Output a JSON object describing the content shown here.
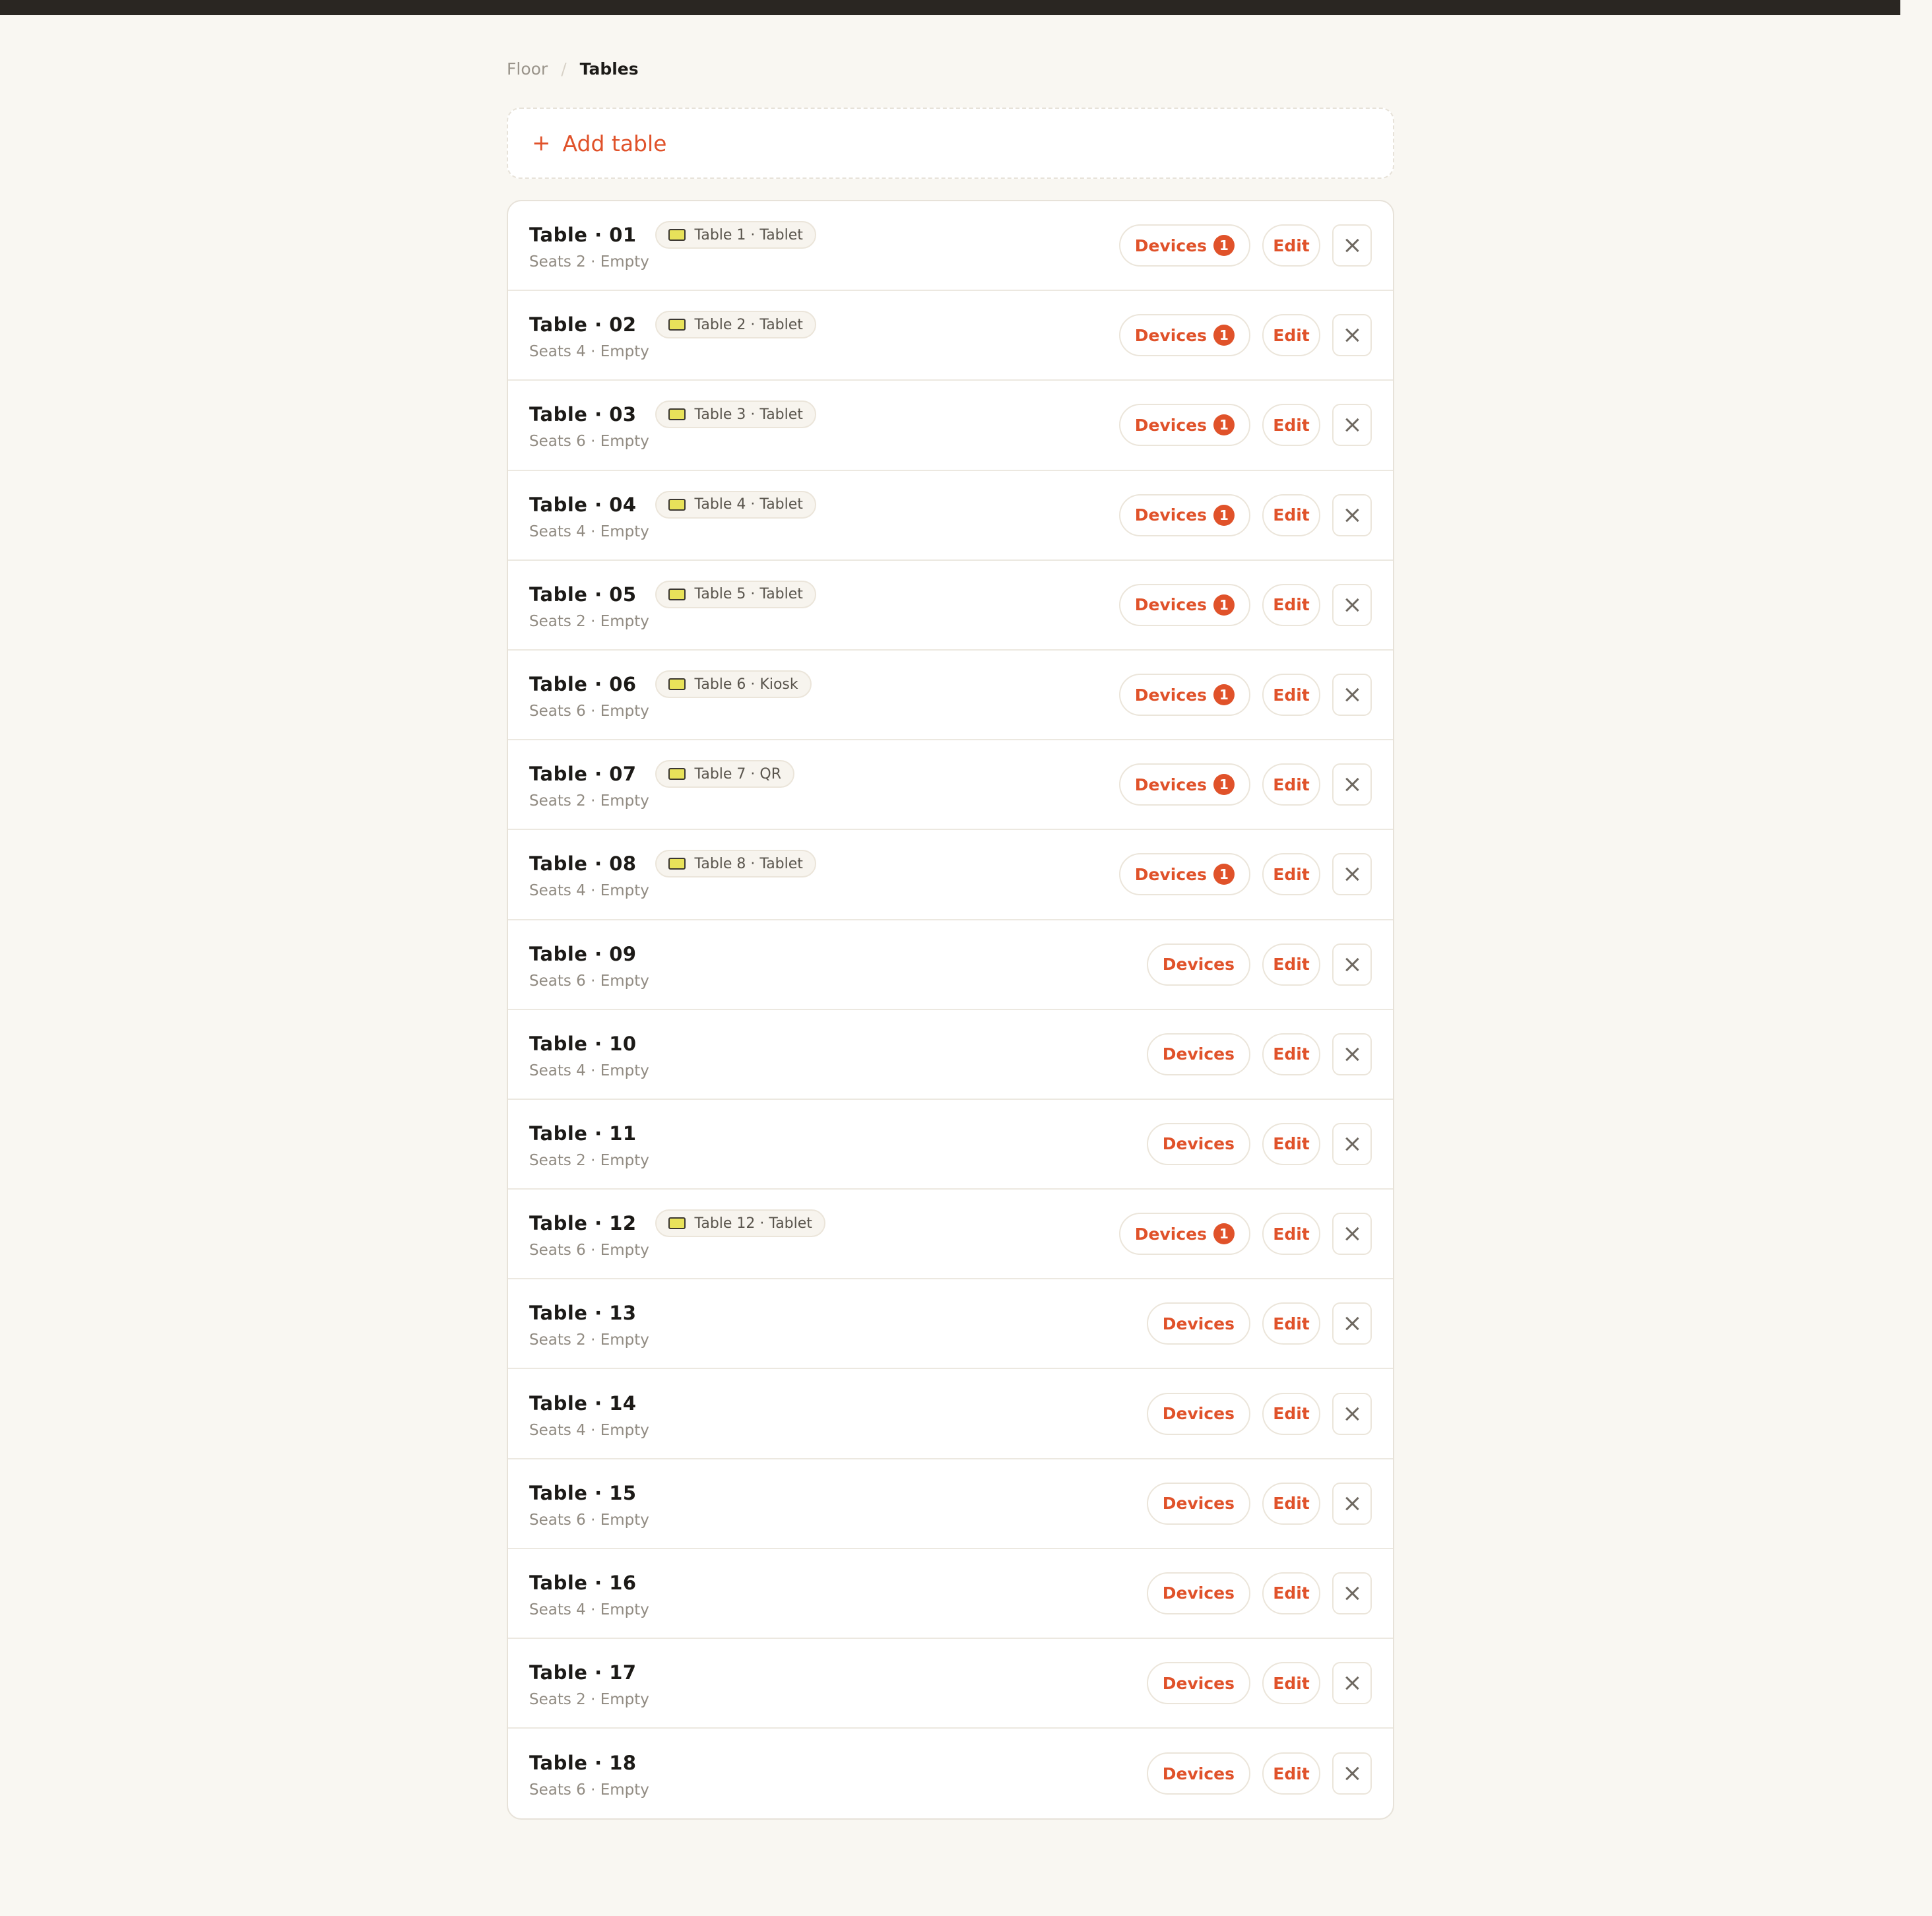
{
  "breadcrumb": {
    "parent": "Floor",
    "separator": "/",
    "current": "Tables"
  },
  "add_table": {
    "plus": "+",
    "label": "Add table"
  },
  "buttons": {
    "devices": "Devices",
    "edit": "Edit"
  },
  "icons": {
    "device_chip": "tablet-icon",
    "remove": "close-icon",
    "add": "plus-icon"
  },
  "colors": {
    "accent": "#e0522a",
    "background": "#f9f7f2",
    "topbar": "#2a2622"
  },
  "tables": [
    {
      "name": "Table · 01",
      "sub": "Seats 2 · Empty",
      "device": "Table 1 · Tablet",
      "device_count": "1"
    },
    {
      "name": "Table · 02",
      "sub": "Seats 4 · Empty",
      "device": "Table 2 · Tablet",
      "device_count": "1"
    },
    {
      "name": "Table · 03",
      "sub": "Seats 6 · Empty",
      "device": "Table 3 · Tablet",
      "device_count": "1"
    },
    {
      "name": "Table · 04",
      "sub": "Seats 4 · Empty",
      "device": "Table 4 · Tablet",
      "device_count": "1"
    },
    {
      "name": "Table · 05",
      "sub": "Seats 2 · Empty",
      "device": "Table 5 · Tablet",
      "device_count": "1"
    },
    {
      "name": "Table · 06",
      "sub": "Seats 6 · Empty",
      "device": "Table 6 · Kiosk",
      "device_count": "1"
    },
    {
      "name": "Table · 07",
      "sub": "Seats 2 · Empty",
      "device": "Table 7 · QR",
      "device_count": "1"
    },
    {
      "name": "Table · 08",
      "sub": "Seats 4 · Empty",
      "device": "Table 8 · Tablet",
      "device_count": "1"
    },
    {
      "name": "Table · 09",
      "sub": "Seats 6 · Empty",
      "device": null,
      "device_count": null
    },
    {
      "name": "Table · 10",
      "sub": "Seats 4 · Empty",
      "device": null,
      "device_count": null
    },
    {
      "name": "Table · 11",
      "sub": "Seats 2 · Empty",
      "device": null,
      "device_count": null
    },
    {
      "name": "Table · 12",
      "sub": "Seats 6 · Empty",
      "device": "Table 12 · Tablet",
      "device_count": "1"
    },
    {
      "name": "Table · 13",
      "sub": "Seats 2 · Empty",
      "device": null,
      "device_count": null
    },
    {
      "name": "Table · 14",
      "sub": "Seats 4 · Empty",
      "device": null,
      "device_count": null
    },
    {
      "name": "Table · 15",
      "sub": "Seats 6 · Empty",
      "device": null,
      "device_count": null
    },
    {
      "name": "Table · 16",
      "sub": "Seats 4 · Empty",
      "device": null,
      "device_count": null
    },
    {
      "name": "Table · 17",
      "sub": "Seats 2 · Empty",
      "device": null,
      "device_count": null
    },
    {
      "name": "Table · 18",
      "sub": "Seats 6 · Empty",
      "device": null,
      "device_count": null
    }
  ]
}
